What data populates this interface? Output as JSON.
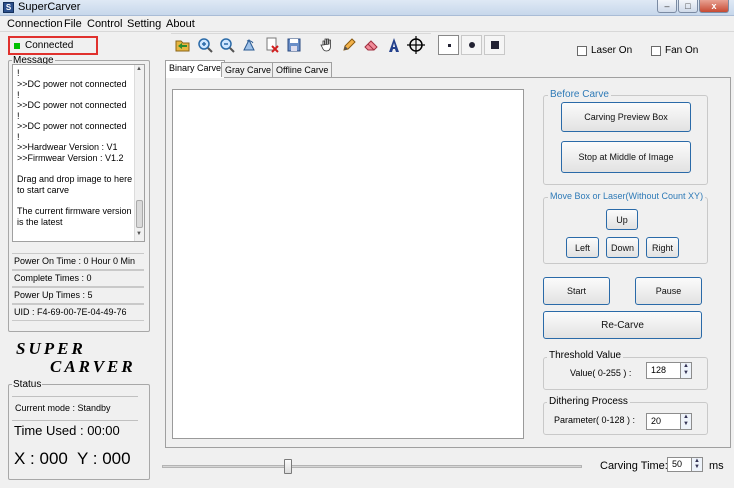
{
  "window": {
    "title": "SuperCarver",
    "app_icon_glyph": "S"
  },
  "menu": [
    "Connection",
    "File",
    "Control",
    "Setting",
    "About"
  ],
  "connection": {
    "label": "Connected",
    "indicator_color": "#00c000"
  },
  "message_panel": {
    "label": "Message",
    "lines": [
      "!",
      ">>DC power not connected",
      "!",
      ">>DC power not connected",
      "!",
      ">>DC power not connected",
      "!",
      ">>Hardwear Version : V1",
      ">>Firmwear Version : V1.2",
      "",
      "Drag and drop image to here",
      "to start carve",
      "",
      "The current firmware version",
      "is the latest"
    ]
  },
  "info": {
    "power_on_time": "Power On Time : 0 Hour 0 Min",
    "complete_times": "Complete Times : 0",
    "power_up_times": "Power Up Times : 5",
    "uid": "UID : F4-69-00-7E-04-49-76"
  },
  "logo": {
    "line1": "SUPER",
    "line2": "CARVER"
  },
  "status": {
    "label": "Status",
    "current_mode": "Current mode : Standby",
    "time_used": "Time Used :  00:00",
    "coords": "X : 000  Y : 000"
  },
  "toolbar": {
    "icons": [
      "open-folder-icon",
      "zoom-in-icon",
      "zoom-out-icon",
      "rotate-icon",
      "delete-image-icon",
      "save-icon",
      "hand-icon",
      "pencil-icon",
      "eraser-icon",
      "text-icon",
      "crosshair-icon"
    ],
    "point_sizes": [
      "small-dot-icon",
      "medium-dot-icon",
      "large-dot-icon"
    ]
  },
  "checkboxes": {
    "laser_on": "Laser On",
    "fan_on": "Fan On"
  },
  "tabs": [
    "Binary Carve",
    "Gray Carve",
    "Offline Carve"
  ],
  "before_carve": {
    "label": "Before Carve",
    "preview_box": "Carving Preview Box",
    "stop_middle": "Stop at Middle of Image"
  },
  "move": {
    "label": "Move Box or Laser(Without Count XY)",
    "up": "Up",
    "left": "Left",
    "down": "Down",
    "right": "Right"
  },
  "controls": {
    "start": "Start",
    "pause": "Pause",
    "recarve": "Re-Carve"
  },
  "threshold": {
    "label": "Threshold Value",
    "param_label": "Value( 0-255 ) :",
    "value": "128"
  },
  "dithering": {
    "label": "Dithering Process",
    "param_label": "Parameter( 0-128 ) :",
    "value": "20"
  },
  "carving_time": {
    "label": "Carving Time:",
    "value": "50",
    "unit": "ms"
  },
  "slider": {
    "value_fraction": 0.3
  }
}
